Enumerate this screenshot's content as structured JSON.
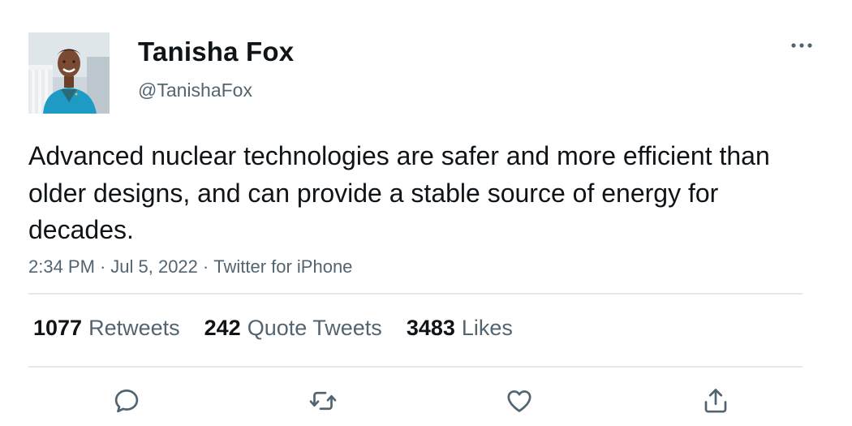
{
  "tweet": {
    "display_name": "Tanisha Fox",
    "handle": "@TanishaFox",
    "text": "Advanced nuclear technologies are safer and more efficient than older designs, and can provide a stable source of energy for decades.",
    "time": "2:34 PM",
    "date": "Jul 5, 2022",
    "source": "Twitter for iPhone",
    "separator": "·"
  },
  "stats": {
    "retweets": {
      "count": "1077",
      "label": "Retweets"
    },
    "quote_tweets": {
      "count": "242",
      "label": "Quote Tweets"
    },
    "likes": {
      "count": "3483",
      "label": "Likes"
    }
  },
  "icons": {
    "more": "more-horizontal-icon",
    "reply": "reply-icon",
    "retweet": "retweet-icon",
    "like": "heart-icon",
    "share": "share-icon"
  },
  "colors": {
    "primary_text": "#0f1419",
    "secondary_text": "#536471",
    "divider": "#e4e8eb",
    "avatar_jacket": "#1d9bc4"
  }
}
